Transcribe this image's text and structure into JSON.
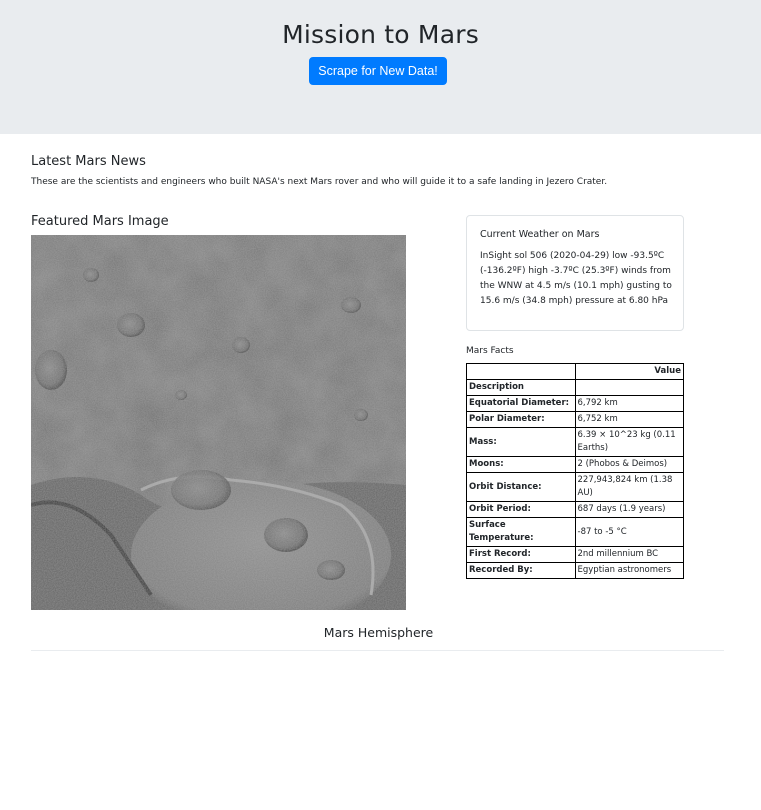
{
  "header": {
    "title": "Mission to Mars",
    "scrape_label": "Scrape for New Data!"
  },
  "news": {
    "heading": "Latest Mars News",
    "paragraph": "These are the scientists and engineers who built NASA's next Mars rover and who will guide it to a safe landing in Jezero Crater."
  },
  "featured": {
    "heading": "Featured Mars Image"
  },
  "weather": {
    "heading": "Current Weather on Mars",
    "text": "InSight sol 506 (2020-04-29) low -93.5ºC (-136.2ºF) high -3.7ºC (25.3ºF) winds from the WNW at 4.5 m/s (10.1 mph) gusting to 15.6 m/s (34.8 mph) pressure at 6.80 hPa"
  },
  "facts": {
    "heading": "Mars Facts",
    "header_value": "Value",
    "rows": [
      {
        "label": "Description",
        "value": ""
      },
      {
        "label": "Equatorial Diameter:",
        "value": "6,792 km"
      },
      {
        "label": "Polar Diameter:",
        "value": "6,752 km"
      },
      {
        "label": "Mass:",
        "value": "6.39 × 10^23 kg (0.11 Earths)"
      },
      {
        "label": "Moons:",
        "value": "2 (Phobos & Deimos)"
      },
      {
        "label": "Orbit Distance:",
        "value": "227,943,824 km (1.38 AU)"
      },
      {
        "label": "Orbit Period:",
        "value": "687 days (1.9 years)"
      },
      {
        "label": "Surface Temperature:",
        "value": "-87 to -5 °C"
      },
      {
        "label": "First Record:",
        "value": "2nd millennium BC"
      },
      {
        "label": "Recorded By:",
        "value": "Egyptian astronomers"
      }
    ]
  },
  "hemispheres": {
    "heading": "Mars Hemisphere"
  }
}
